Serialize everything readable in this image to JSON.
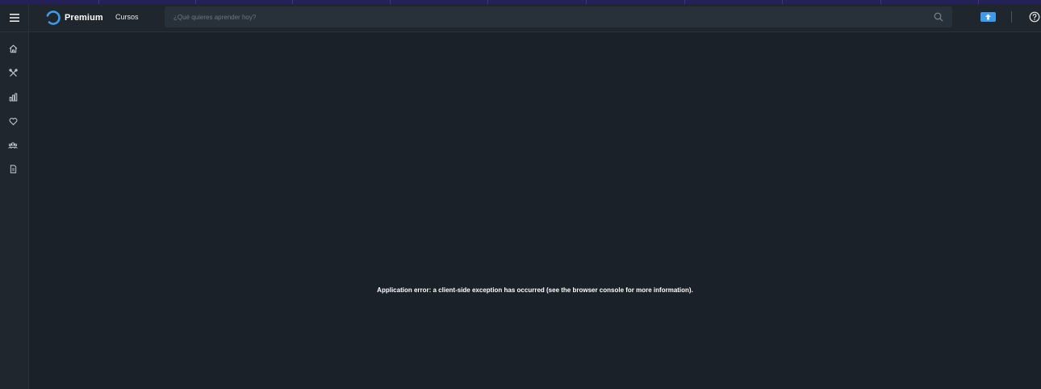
{
  "header": {
    "logo_text": "Premium",
    "nav": {
      "courses_label": "Cursos"
    },
    "search": {
      "placeholder": "¿Qué quieres aprender hoy?",
      "value": ""
    }
  },
  "sidebar": {
    "items": [
      {
        "name": "home",
        "icon": "home-icon"
      },
      {
        "name": "tools",
        "icon": "tools-icon"
      },
      {
        "name": "stats",
        "icon": "bar-chart-icon"
      },
      {
        "name": "favorites",
        "icon": "heart-icon"
      },
      {
        "name": "community",
        "icon": "users-icon"
      },
      {
        "name": "documents",
        "icon": "document-icon"
      }
    ]
  },
  "main": {
    "error_message": "Application error: a client-side exception has occurred (see the browser console for more information)."
  },
  "colors": {
    "background": "#1b2129",
    "header": "#1f262e",
    "accent": "#3d9be9",
    "top_stripe": "#24215a"
  }
}
